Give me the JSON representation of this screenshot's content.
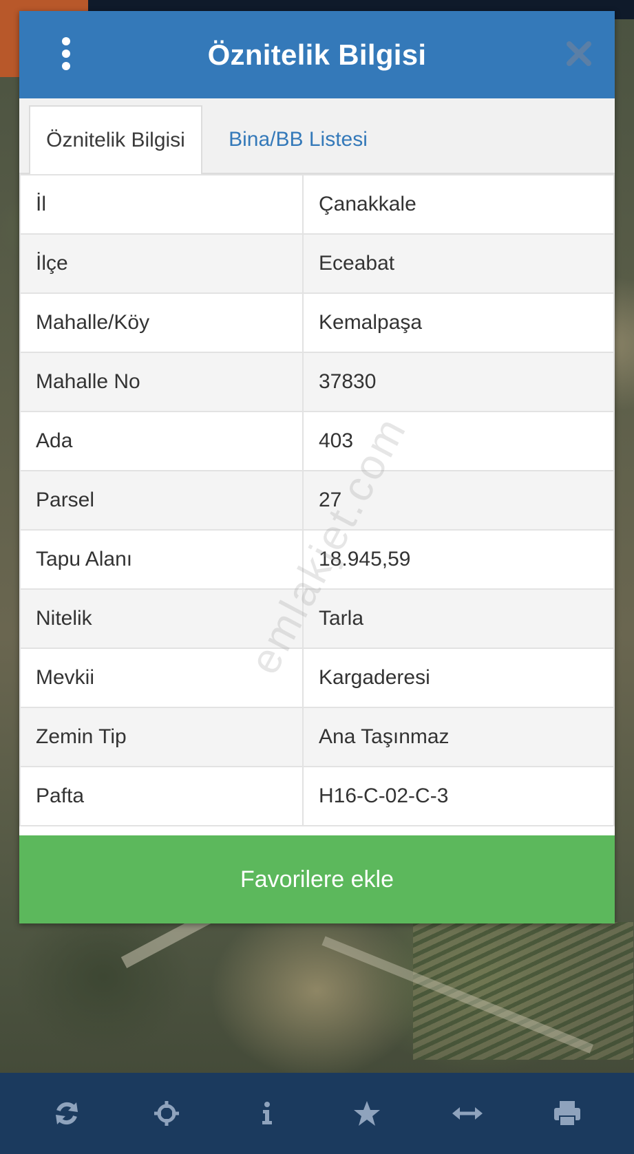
{
  "dialog": {
    "title": "Öznitelik Bilgisi",
    "tabs": [
      {
        "label": "Öznitelik Bilgisi",
        "active": true
      },
      {
        "label": "Bina/BB Listesi",
        "active": false
      }
    ],
    "rows": [
      {
        "key": "İl",
        "value": "Çanakkale"
      },
      {
        "key": "İlçe",
        "value": "Eceabat"
      },
      {
        "key": "Mahalle/Köy",
        "value": "Kemalpaşa"
      },
      {
        "key": "Mahalle No",
        "value": "37830"
      },
      {
        "key": "Ada",
        "value": "403"
      },
      {
        "key": "Parsel",
        "value": "27"
      },
      {
        "key": "Tapu Alanı",
        "value": "18.945,59"
      },
      {
        "key": "Nitelik",
        "value": "Tarla"
      },
      {
        "key": "Mevkii",
        "value": "Kargaderesi"
      },
      {
        "key": "Zemin Tip",
        "value": "Ana Taşınmaz"
      },
      {
        "key": "Pafta",
        "value": "H16-C-02-C-3"
      }
    ],
    "favorite_label": "Favorilere ekle"
  },
  "watermark": "emlakjet.com",
  "toolbar": {
    "icons": [
      "refresh-icon",
      "crosshair-icon",
      "info-icon",
      "star-icon",
      "arrows-horizontal-icon",
      "print-icon"
    ]
  },
  "colors": {
    "header": "#3479b9",
    "favorite": "#5cb85c",
    "toolbar": "#1b3a5e",
    "tool_icon": "#8fa3bd"
  }
}
